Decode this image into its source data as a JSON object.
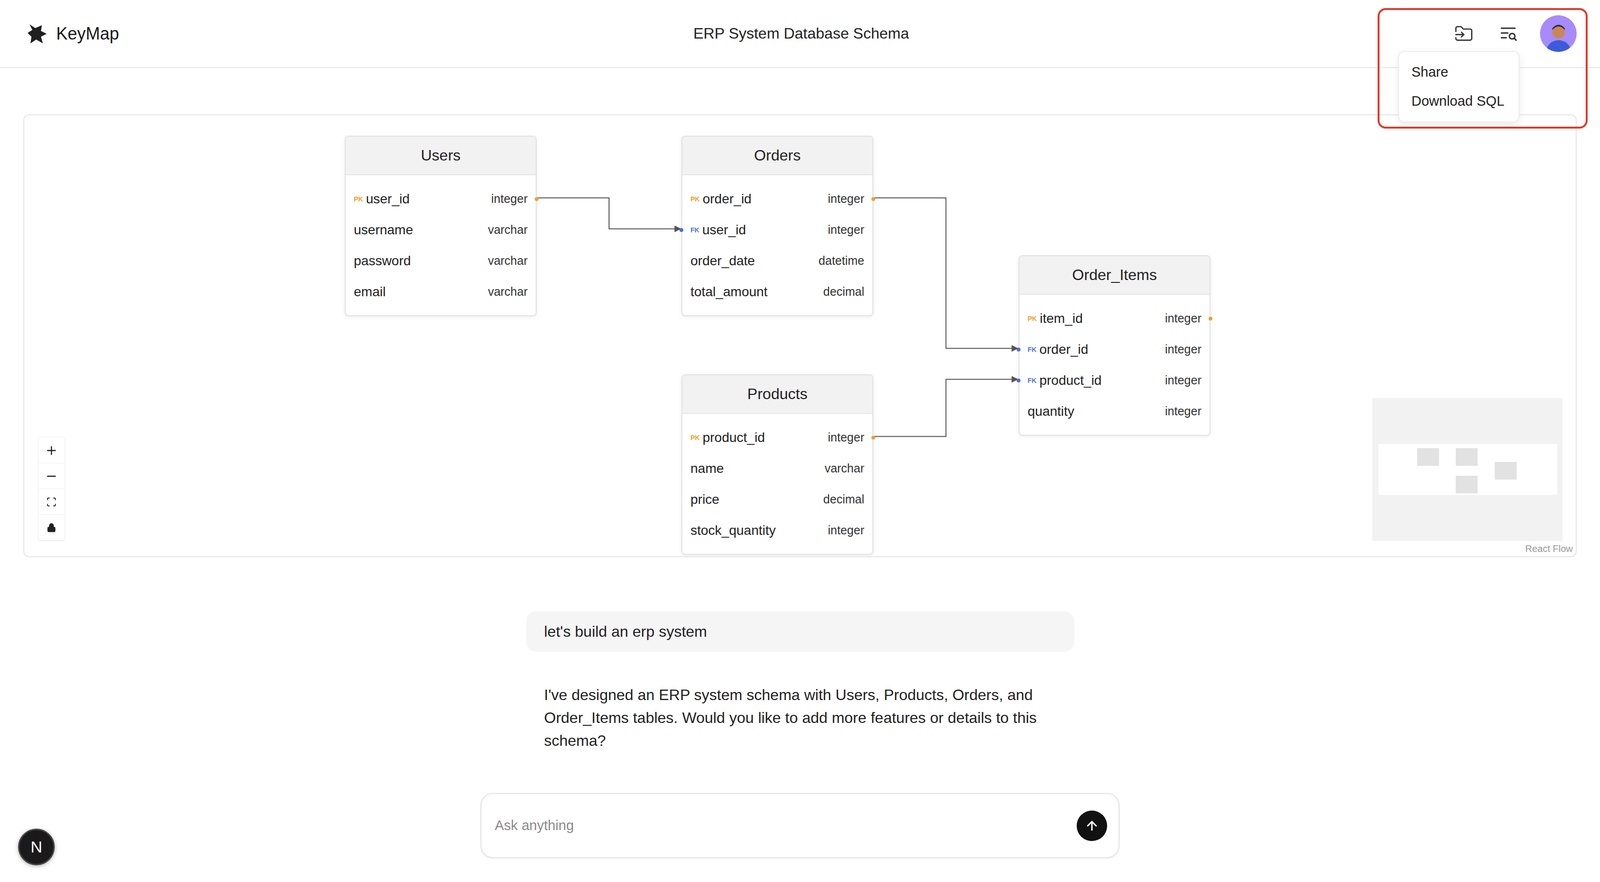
{
  "header": {
    "logo": "KeyMap",
    "title": "ERP System Database Schema"
  },
  "menu": {
    "open": true,
    "items": [
      "Share",
      "Download SQL"
    ]
  },
  "diagram": {
    "tables": [
      {
        "name": "Users",
        "columns": [
          {
            "name": "user_id",
            "type": "integer",
            "key": "PK"
          },
          {
            "name": "username",
            "type": "varchar",
            "key": ""
          },
          {
            "name": "password",
            "type": "varchar",
            "key": ""
          },
          {
            "name": "email",
            "type": "varchar",
            "key": ""
          }
        ]
      },
      {
        "name": "Orders",
        "columns": [
          {
            "name": "order_id",
            "type": "integer",
            "key": "PK"
          },
          {
            "name": "user_id",
            "type": "integer",
            "key": "FK"
          },
          {
            "name": "order_date",
            "type": "datetime",
            "key": ""
          },
          {
            "name": "total_amount",
            "type": "decimal",
            "key": ""
          }
        ]
      },
      {
        "name": "Order_Items",
        "columns": [
          {
            "name": "item_id",
            "type": "integer",
            "key": "PK"
          },
          {
            "name": "order_id",
            "type": "integer",
            "key": "FK"
          },
          {
            "name": "product_id",
            "type": "integer",
            "key": "FK"
          },
          {
            "name": "quantity",
            "type": "integer",
            "key": ""
          }
        ]
      },
      {
        "name": "Products",
        "columns": [
          {
            "name": "product_id",
            "type": "integer",
            "key": "PK"
          },
          {
            "name": "name",
            "type": "varchar",
            "key": ""
          },
          {
            "name": "price",
            "type": "decimal",
            "key": ""
          },
          {
            "name": "stock_quantity",
            "type": "integer",
            "key": ""
          }
        ]
      }
    ],
    "relations": [
      {
        "from": {
          "table": "Users",
          "column": "user_id"
        },
        "to": {
          "table": "Orders",
          "column": "user_id"
        }
      },
      {
        "from": {
          "table": "Orders",
          "column": "order_id"
        },
        "to": {
          "table": "Order_Items",
          "column": "order_id"
        }
      },
      {
        "from": {
          "table": "Products",
          "column": "product_id"
        },
        "to": {
          "table": "Order_Items",
          "column": "product_id"
        }
      }
    ],
    "attribution": "React Flow"
  },
  "chat": {
    "messages": [
      {
        "role": "user",
        "text": "let's build an erp system"
      },
      {
        "role": "assistant",
        "text": "I've designed an ERP system schema with Users, Products, Orders, and Order_Items tables. Would you like to add more features or details to this schema?"
      }
    ],
    "input": {
      "placeholder": "Ask anything"
    }
  },
  "dev_badge": "N"
}
